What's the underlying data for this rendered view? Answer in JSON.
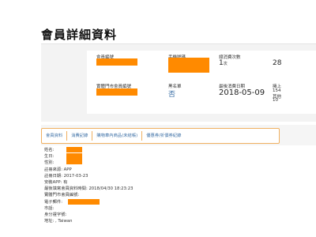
{
  "page": {
    "title": "會員詳細資料"
  },
  "summary": {
    "member_no_label": "會員編號",
    "phone_label": "手機號碼",
    "purchase_count_label": "總消費次數",
    "purchase_count_value": "1",
    "purchase_count_unit": "次",
    "partial_right_value_1": "28",
    "physical_member_no_label": "實體門市會員編號",
    "blacklist_label": "黑名單",
    "blacklist_value": "否",
    "last_purchase_label": "最後消費日期",
    "last_purchase_value": "2018-05-09",
    "partial_right_label": "擁上",
    "partial_right_value_2": "154",
    "partial_right_value_3": "其他",
    "partial_right_value_4": "10"
  },
  "tabs": [
    "會員資料",
    "消費記錄",
    "購物車內商品(未結帳)",
    "優惠券/折價券紀錄"
  ],
  "details": {
    "name_label": "姓名:",
    "birthday_label": "生日:",
    "gender_label": "性別:",
    "source_label": "註冊來源: APP",
    "register_date_label": "註冊日期: 2017-03-23",
    "app_label": "安裝APP: 有",
    "last_update_label": "最後填寫會員資料時間: 2018/04/30 18:23:23",
    "physical_no_label": "實體門市會員編號:",
    "email_label": "電子郵件:",
    "postal_label": "市話:",
    "id_label": "身分證字號:",
    "address_label": "地址: , Taiwan"
  },
  "colors": {
    "redaction": "#ff8a00",
    "tab_text": "#3a6ea5",
    "tab_border": "#f0b060",
    "blue_value": "#3a6ea5"
  }
}
